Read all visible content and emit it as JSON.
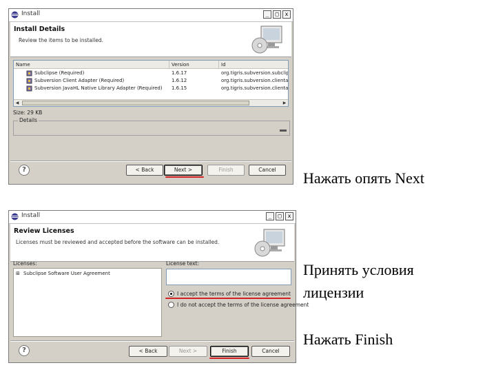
{
  "window1": {
    "title": "Install",
    "header_title": "Install Details",
    "header_subtitle": "Review the items to be installed.",
    "columns": [
      "Name",
      "Version",
      "Id"
    ],
    "rows": [
      {
        "name": "Subclipse (Required)",
        "version": "1.6.17",
        "id": "org.tigris.subversion.subclipse"
      },
      {
        "name": "Subversion Client Adapter (Required)",
        "version": "1.6.12",
        "id": "org.tigris.subversion.clientadapter"
      },
      {
        "name": "Subversion JavaHL Native Library Adapter (Required)",
        "version": "1.6.15",
        "id": "org.tigris.subversion.clientadapter.javahl"
      }
    ],
    "size_label": "Size: 29 KB",
    "details_label": "Details",
    "buttons": {
      "back": "< Back",
      "next": "Next >",
      "finish": "Finish",
      "cancel": "Cancel"
    }
  },
  "window2": {
    "title": "Install",
    "header_title": "Review Licenses",
    "header_subtitle": "Licenses must be reviewed and accepted before the software can be installed.",
    "licenses_label": "Licenses:",
    "license_item": "Subclipse Software User Agreement",
    "license_text_label": "License text:",
    "accept_label": "I accept the terms of the license agreement",
    "decline_label": "I do not accept the terms of the license agreement",
    "accept_selected": true,
    "buttons": {
      "back": "< Back",
      "next": "Next >",
      "finish": "Finish",
      "cancel": "Cancel"
    }
  },
  "captions": {
    "c1": "Нажать опять Next",
    "c2_line1": "Принять условия",
    "c2_line2": "лицензии",
    "c3": "Нажать Finish"
  },
  "colors": {
    "highlight_underline": "#d42020",
    "dialog_bg": "#d4d0c8"
  }
}
